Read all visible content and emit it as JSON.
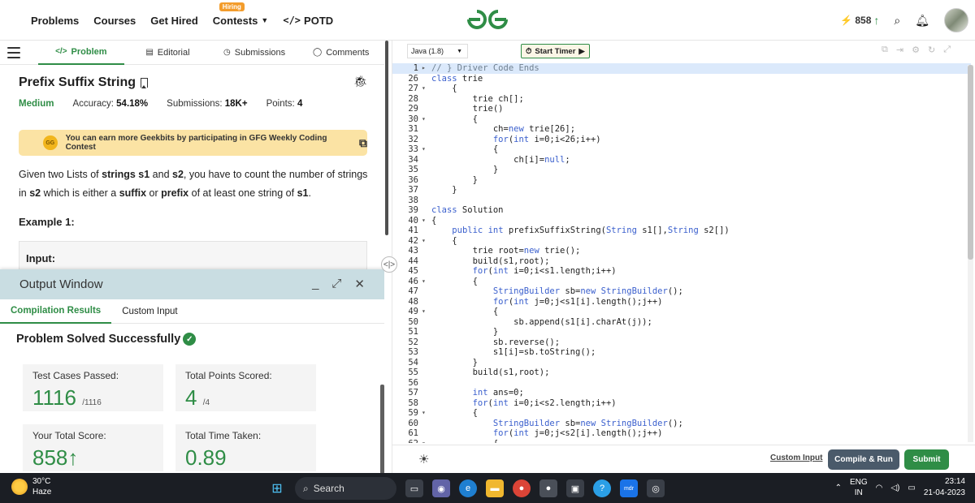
{
  "nav": {
    "links": [
      "Problems",
      "Courses",
      "Get Hired",
      "Contests",
      "POTD"
    ],
    "hiring_badge": "Hiring",
    "potd_code": "</>",
    "streak": "858",
    "logo_icon": "gfg-logo-icon"
  },
  "tabs": [
    "Problem",
    "Editorial",
    "Submissions",
    "Comments"
  ],
  "problem": {
    "title": "Prefix Suffix String",
    "difficulty": "Medium",
    "accuracy_label": "Accuracy:",
    "accuracy": "54.18%",
    "submissions_label": "Submissions:",
    "submissions": "18K+",
    "points_label": "Points:",
    "points": "4",
    "banner": "You can earn more Geekbits by participating in GFG Weekly Coding Contest",
    "coin_label": "GG",
    "desc_1": "Given two Lists of ",
    "desc_b1": "strings s1",
    "desc_2": " and ",
    "desc_b2": "s2",
    "desc_3": ", you have to count the number of strings in ",
    "desc_b3": "s2",
    "desc_4": " which is either a ",
    "desc_b4": "suffix",
    "desc_5": " or ",
    "desc_b5": "prefix",
    "desc_6": " of at least one string of ",
    "desc_b6": "s1",
    "desc_7": ".",
    "example": "Example 1:",
    "input_label": "Input:"
  },
  "output": {
    "title": "Output Window",
    "tabs": [
      "Compilation Results",
      "Custom Input"
    ],
    "status": "Problem Solved Successfully",
    "stats": [
      {
        "label": "Test Cases Passed:",
        "value": "1116",
        "suffix": "/1116"
      },
      {
        "label": "Total Points Scored:",
        "value": "4",
        "suffix": "/4"
      },
      {
        "label": "Your Total Score:",
        "value": "858",
        "suffix": "↑"
      },
      {
        "label": "Total Time Taken:",
        "value": "0.89",
        "suffix": ""
      }
    ]
  },
  "editor": {
    "language": "Java (1.8)",
    "timer": "Start Timer",
    "custom_input": "Custom Input",
    "compile_run": "Compile & Run",
    "submit": "Submit",
    "lines": [
      {
        "n": "1",
        "f": "▸",
        "t": "// } Driver Code Ends",
        "hl": true
      },
      {
        "n": "26",
        "f": "",
        "t": "class trie"
      },
      {
        "n": "27",
        "f": "▾",
        "t": "    {"
      },
      {
        "n": "28",
        "f": "",
        "t": "        trie ch[];"
      },
      {
        "n": "29",
        "f": "",
        "t": "        trie()"
      },
      {
        "n": "30",
        "f": "▾",
        "t": "        {"
      },
      {
        "n": "31",
        "f": "",
        "t": "            ch=new trie[26];"
      },
      {
        "n": "32",
        "f": "",
        "t": "            for(int i=0;i<26;i++)"
      },
      {
        "n": "33",
        "f": "▾",
        "t": "            {"
      },
      {
        "n": "34",
        "f": "",
        "t": "                ch[i]=null;"
      },
      {
        "n": "35",
        "f": "",
        "t": "            }"
      },
      {
        "n": "36",
        "f": "",
        "t": "        }"
      },
      {
        "n": "37",
        "f": "",
        "t": "    }"
      },
      {
        "n": "38",
        "f": "",
        "t": ""
      },
      {
        "n": "39",
        "f": "",
        "t": "class Solution"
      },
      {
        "n": "40",
        "f": "▾",
        "t": "{"
      },
      {
        "n": "41",
        "f": "",
        "t": "    public int prefixSuffixString(String s1[],String s2[])"
      },
      {
        "n": "42",
        "f": "▾",
        "t": "    {"
      },
      {
        "n": "43",
        "f": "",
        "t": "        trie root=new trie();"
      },
      {
        "n": "44",
        "f": "",
        "t": "        build(s1,root);"
      },
      {
        "n": "45",
        "f": "",
        "t": "        for(int i=0;i<s1.length;i++)"
      },
      {
        "n": "46",
        "f": "▾",
        "t": "        {"
      },
      {
        "n": "47",
        "f": "",
        "t": "            StringBuilder sb=new StringBuilder();"
      },
      {
        "n": "48",
        "f": "",
        "t": "            for(int j=0;j<s1[i].length();j++)"
      },
      {
        "n": "49",
        "f": "▾",
        "t": "            {"
      },
      {
        "n": "50",
        "f": "",
        "t": "                sb.append(s1[i].charAt(j));"
      },
      {
        "n": "51",
        "f": "",
        "t": "            }"
      },
      {
        "n": "52",
        "f": "",
        "t": "            sb.reverse();"
      },
      {
        "n": "53",
        "f": "",
        "t": "            s1[i]=sb.toString();"
      },
      {
        "n": "54",
        "f": "",
        "t": "        }"
      },
      {
        "n": "55",
        "f": "",
        "t": "        build(s1,root);"
      },
      {
        "n": "56",
        "f": "",
        "t": ""
      },
      {
        "n": "57",
        "f": "",
        "t": "        int ans=0;"
      },
      {
        "n": "58",
        "f": "",
        "t": "        for(int i=0;i<s2.length;i++)"
      },
      {
        "n": "59",
        "f": "▾",
        "t": "        {"
      },
      {
        "n": "60",
        "f": "",
        "t": "            StringBuilder sb=new StringBuilder();"
      },
      {
        "n": "61",
        "f": "",
        "t": "            for(int j=0;j<s2[i].length();j++)"
      },
      {
        "n": "62",
        "f": "▾",
        "t": "            {"
      }
    ]
  },
  "taskbar": {
    "temp": "30°C",
    "weather": "Haze",
    "search": "Search",
    "lang": "ENG",
    "region": "IN",
    "time": "23:14",
    "date": "21-04-2023"
  },
  "colors": {
    "accent": "#2f8d46",
    "taskbar": "#1b1e24",
    "output_header": "#c9dde2"
  }
}
